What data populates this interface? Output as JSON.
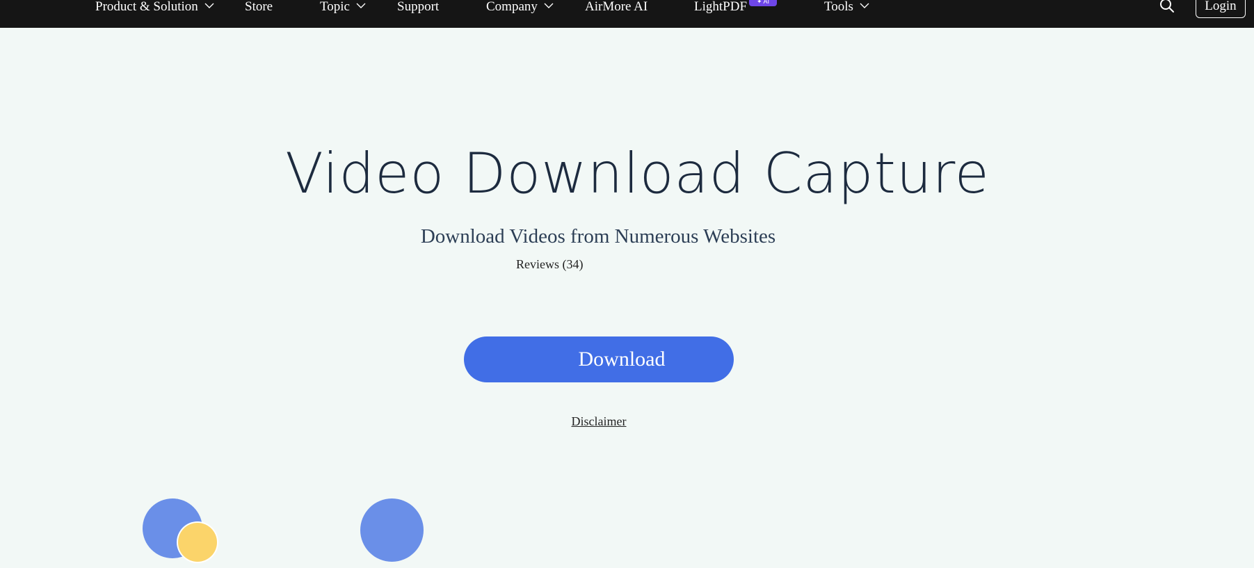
{
  "nav": {
    "items": [
      {
        "label": "Product & Solution",
        "has_dropdown": true
      },
      {
        "label": "Store",
        "has_dropdown": false
      },
      {
        "label": "Topic",
        "has_dropdown": true
      },
      {
        "label": "Support",
        "has_dropdown": false
      },
      {
        "label": "Company",
        "has_dropdown": true
      },
      {
        "label": "AirMore AI",
        "has_dropdown": false
      },
      {
        "label": "LightPDF",
        "has_dropdown": false,
        "badge": "AI"
      },
      {
        "label": "Tools",
        "has_dropdown": true
      }
    ],
    "search_icon": "search-icon",
    "login_label": "Login"
  },
  "hero": {
    "title": "Video Download Capture",
    "subtitle": "Download Videos from Numerous Websites",
    "reviews": "Reviews (34)",
    "download_label": "Download",
    "disclaimer": "Disclaimer"
  },
  "colors": {
    "nav_bg": "#151515",
    "page_bg": "#f2f8f6",
    "accent_blue": "#416ee6",
    "circle_blue": "#6a8fe8",
    "circle_yellow": "#fbd46a",
    "ai_badge": "#6e46e8"
  }
}
